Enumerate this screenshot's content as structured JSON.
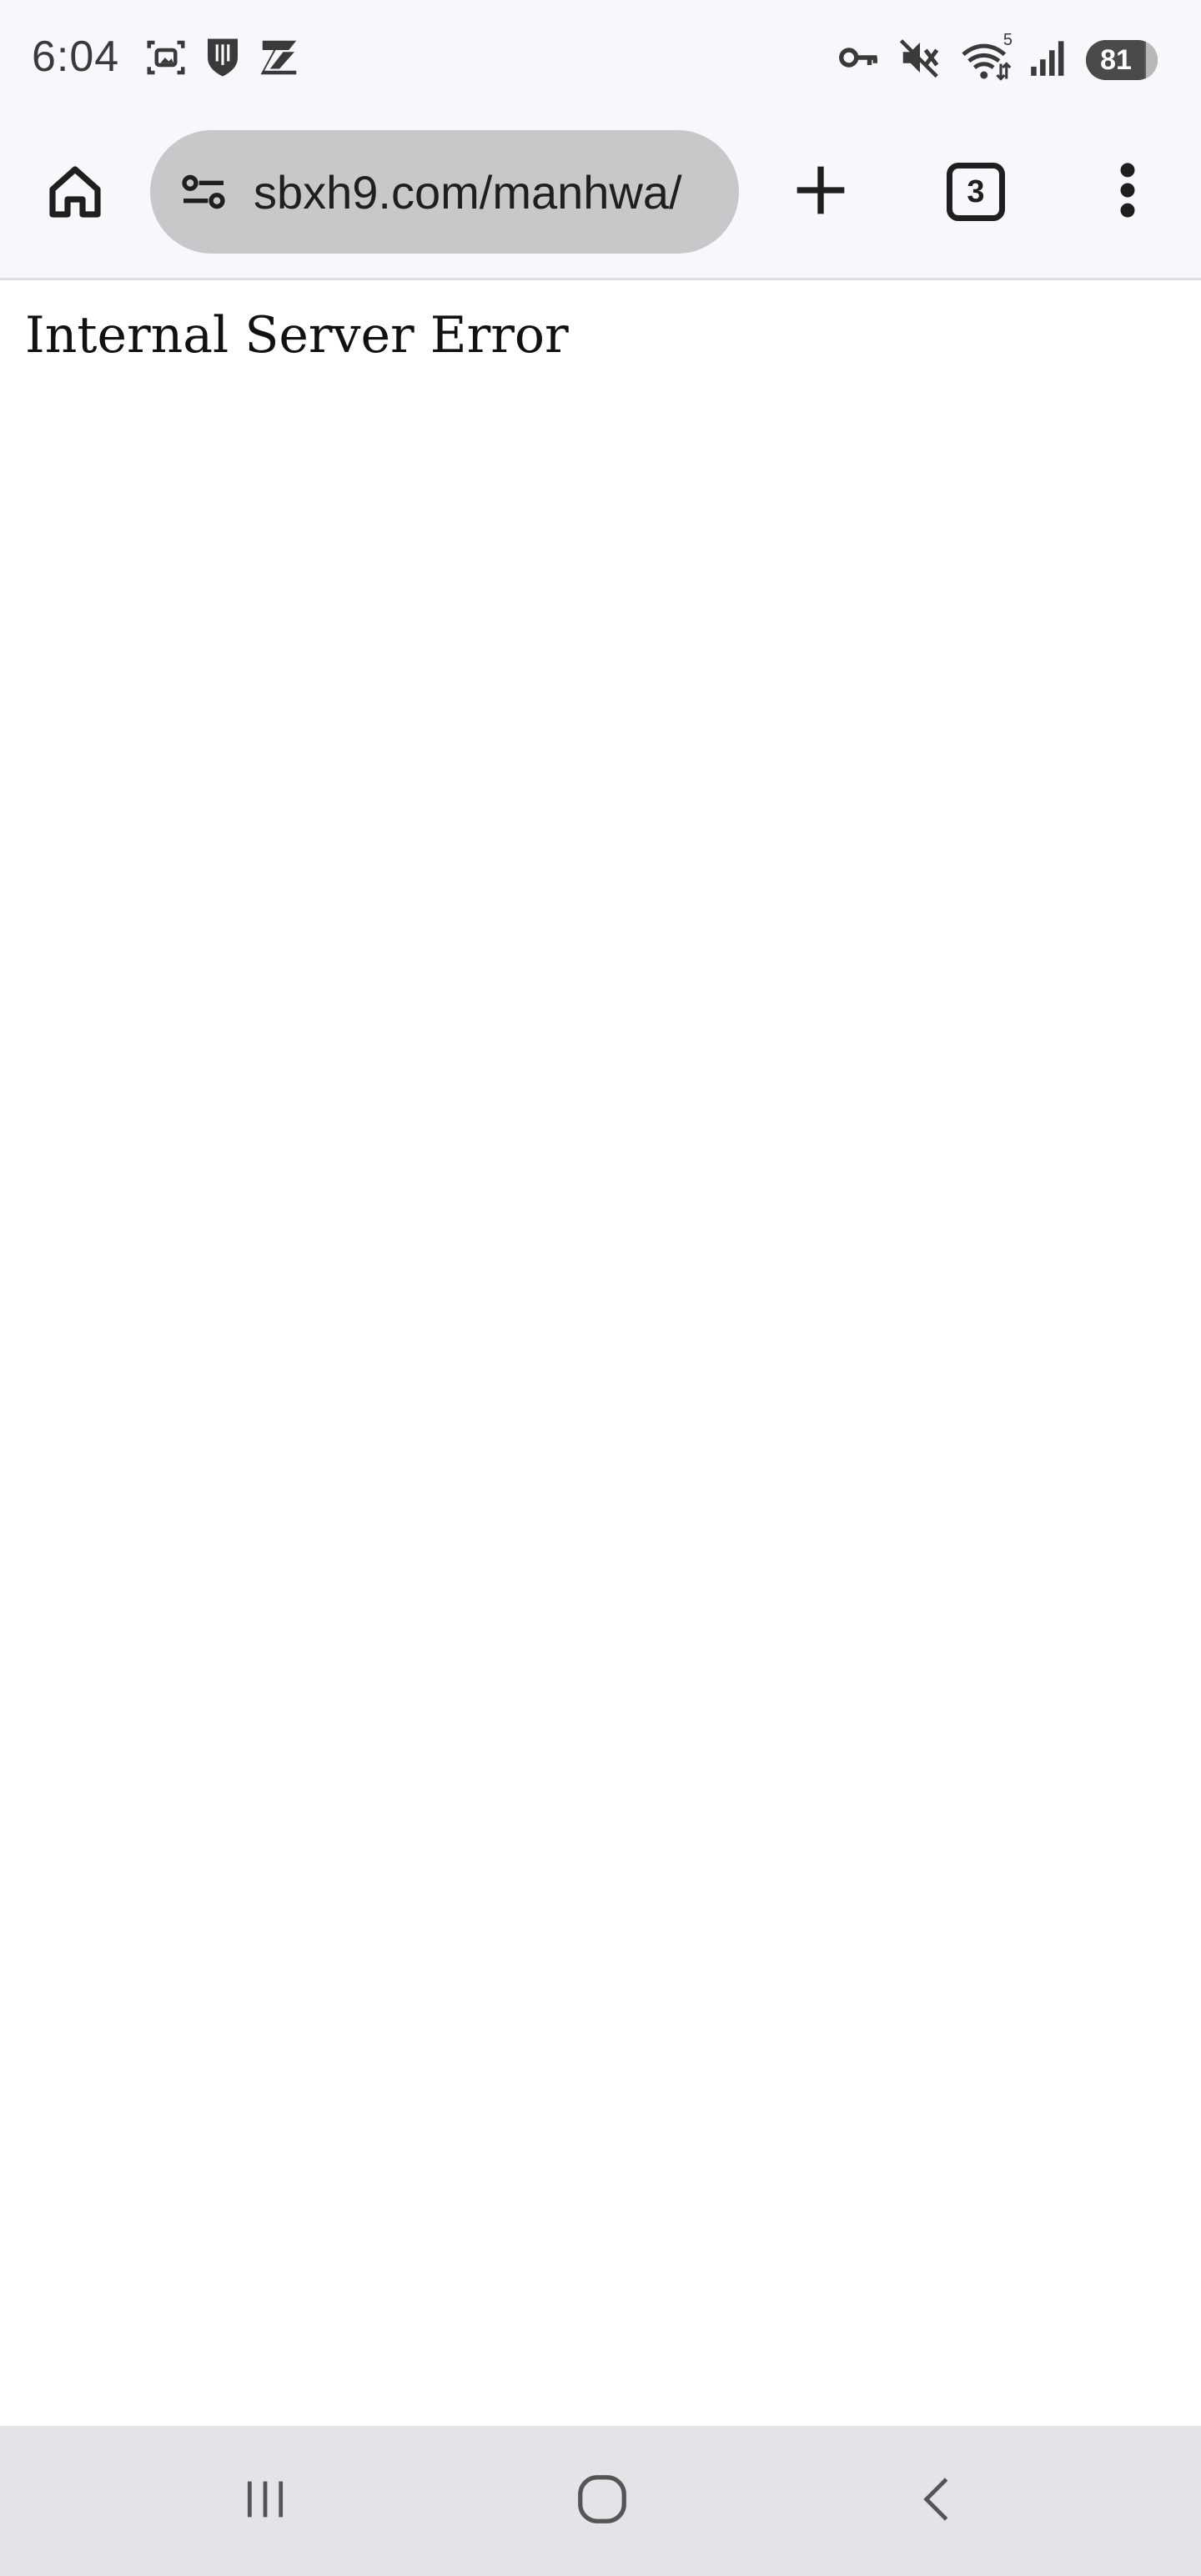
{
  "status_bar": {
    "time": "6:04",
    "battery_level": "81",
    "battery_fraction": 0.81,
    "wifi_label": "5",
    "left_icons": [
      "screenshot-icon",
      "shield-icon",
      "z-app-icon"
    ],
    "right_icons": [
      "vpn-key-icon",
      "mute-icon",
      "wifi-icon",
      "signal-icon",
      "battery-icon"
    ]
  },
  "toolbar": {
    "url": "sbxh9.com/manhwa/",
    "tab_count": "3",
    "icons": [
      "home-icon",
      "site-settings-icon",
      "plus-icon",
      "tab-switcher-icon",
      "more-vert-icon"
    ]
  },
  "page": {
    "error_message": "Internal Server Error"
  },
  "nav_bar": {
    "icons": [
      "recents-icon",
      "home-circle-icon",
      "back-icon"
    ]
  },
  "colors": {
    "chrome_bg": "#f8f8fc",
    "url_bar_bg": "#c8c8ca",
    "nav_bg": "#e4e4e8",
    "text": "#1f1f1f"
  }
}
